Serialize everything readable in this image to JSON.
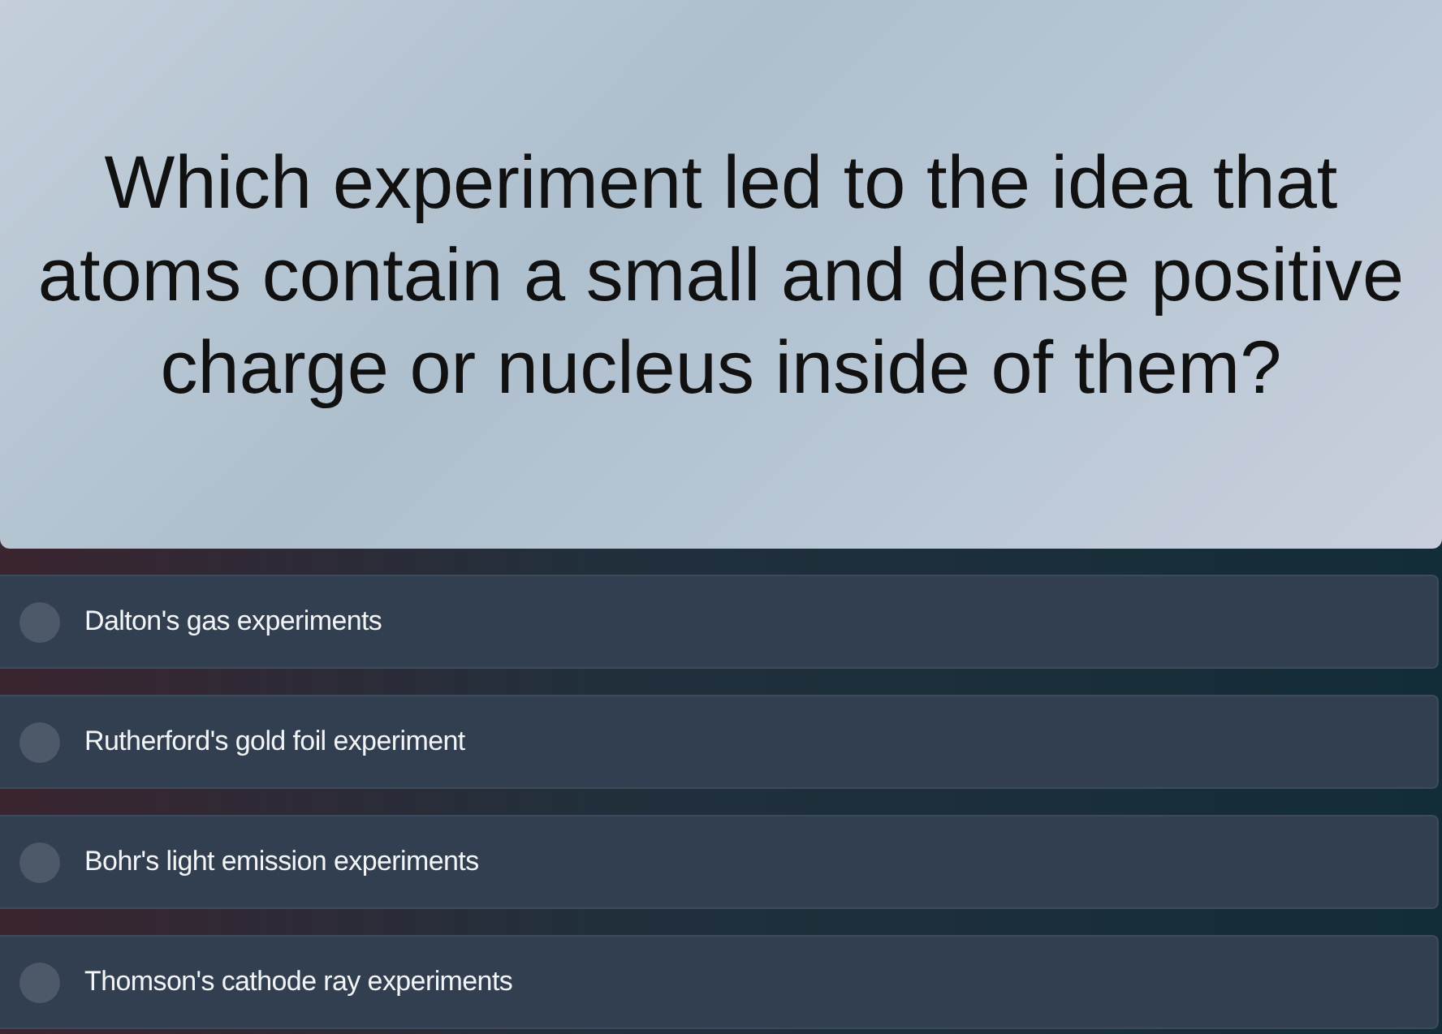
{
  "question": "Which experiment led to the idea that atoms contain a small and dense positive charge or nucleus inside of them?",
  "options": [
    {
      "label": "Dalton's gas experiments",
      "selected": false
    },
    {
      "label": "Rutherford's gold foil experiment",
      "selected": false
    },
    {
      "label": "Bohr's light emission experiments",
      "selected": false
    },
    {
      "label": "Thomson's cathode ray experiments",
      "selected": false
    }
  ]
}
